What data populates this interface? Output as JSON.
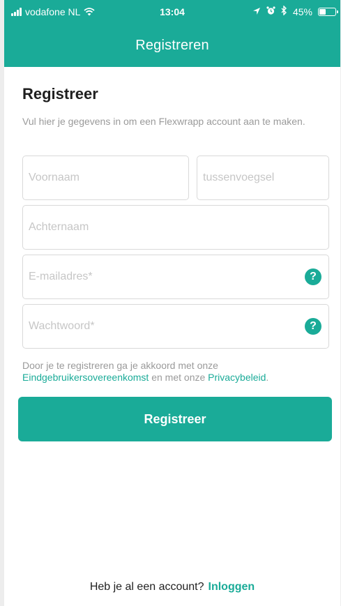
{
  "status_bar": {
    "carrier": "vodafone NL",
    "time": "13:04",
    "battery": "45%",
    "battery_level": 0.45,
    "icons": [
      "signal-icon",
      "wifi-icon",
      "location-arrow-icon",
      "alarm-icon",
      "bluetooth-icon",
      "battery-icon"
    ]
  },
  "nav": {
    "title": "Registreren"
  },
  "form": {
    "title": "Registreer",
    "description": "Vul hier je gegevens in om een Flexwrapp account aan te maken.",
    "fields": {
      "first_name": {
        "placeholder": "Voornaam",
        "value": ""
      },
      "infix": {
        "placeholder": "tussenvoegsel",
        "value": ""
      },
      "last_name": {
        "placeholder": "Achternaam",
        "value": ""
      },
      "email": {
        "placeholder": "E-mailadres*",
        "value": ""
      },
      "password": {
        "placeholder": "Wachtwoord*",
        "value": ""
      }
    },
    "help_label": "?",
    "legal": {
      "prefix": "Door je te registreren ga je akkoord met onze ",
      "terms_link": "Eindgebruikersovereenkomst",
      "middle": " en met onze ",
      "privacy_link": "Privacybeleid",
      "suffix": "."
    },
    "submit_label": "Registreer"
  },
  "footer": {
    "question": "Heb je al een account?",
    "login_link": "Inloggen"
  },
  "colors": {
    "accent": "#1aab98",
    "page_bg": "#ededed",
    "placeholder": "#c6c6c6",
    "muted_text": "#9a9a9a"
  }
}
